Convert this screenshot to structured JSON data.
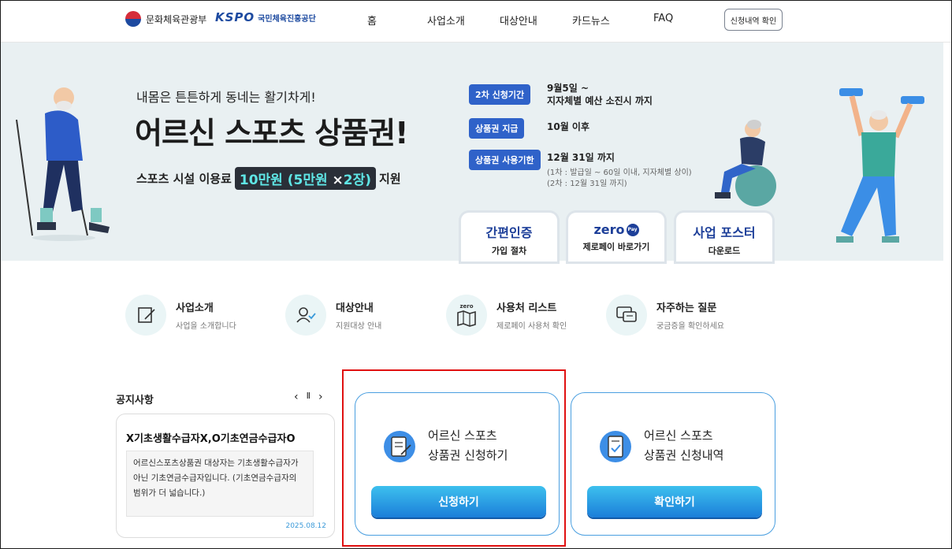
{
  "header": {
    "logo_mcst": "문화체육관광부",
    "logo_kspo": "KSPO",
    "logo_kspo_sub": "국민체육진흥공단",
    "nav": [
      "홈",
      "사업소개",
      "대상안내",
      "카드뉴스",
      "FAQ"
    ],
    "check_button": "신청내역 확인"
  },
  "hero": {
    "subtitle": "내몸은 튼튼하게 동네는 활기차게!",
    "title": "어르신 스포츠 상품권!",
    "line_prefix": "스포츠 시설 이용료",
    "line_amount": "10만원",
    "line_detail_a": "(5만원",
    "line_detail_x": "×",
    "line_detail_b": "2장)",
    "line_suffix": "지원",
    "info": [
      {
        "tag": "2차 신청기간",
        "value_line1": "9월5일 ~",
        "value_line2": "지자체별 예산 소진시 까지"
      },
      {
        "tag": "상품권 지급",
        "value_line1": "10월 이후"
      },
      {
        "tag": "상품권 사용기한",
        "value_line1": "12월 31일 까지",
        "note_line1": "(1차 : 발급일 ~ 60일 이내, 지자체별 상이)",
        "note_line2": "(2차 : 12월 31일 까지)"
      }
    ],
    "cards": [
      {
        "title": "간편인증",
        "sub": "가입 절차"
      },
      {
        "title": "zero",
        "badge": "Pay",
        "sub": "제로페이 바로가기"
      },
      {
        "title": "사업 포스터",
        "sub": "다운로드"
      }
    ]
  },
  "quick_links": [
    {
      "title": "사업소개",
      "desc": "사업을 소개합니다",
      "icon": "edit-document-icon"
    },
    {
      "title": "대상안내",
      "desc": "지원대상 안내",
      "icon": "user-check-icon"
    },
    {
      "title": "사용처 리스트",
      "desc": "제로페이 사용처 확인",
      "icon": "map-icon",
      "icon_label": "zero"
    },
    {
      "title": "자주하는 질문",
      "desc": "궁금증을 확인하세요",
      "icon": "chat-icon"
    }
  ],
  "notice": {
    "title": "공지사항",
    "prev": "‹",
    "pause": "Ⅱ",
    "next": "›",
    "headline": "X기초생활수급자X,O기초연금수급자O",
    "body": "어르신스포츠상품권 대상자는 기초생활수급자가 아닌 기초연금수급자입니다. (기초연금수급자의 범위가 더 넓습니다.)",
    "date": "2025.08.12"
  },
  "actions": [
    {
      "line1": "어르신 스포츠",
      "line2": "상품권 신청하기",
      "button": "신청하기"
    },
    {
      "line1": "어르신 스포츠",
      "line2": "상품권 신청내역",
      "button": "확인하기"
    }
  ],
  "colors": {
    "accent": "#2f62c9",
    "button_top": "#3dc0ee",
    "button_bottom": "#1b7ed9",
    "highlight_border": "#e01010"
  }
}
